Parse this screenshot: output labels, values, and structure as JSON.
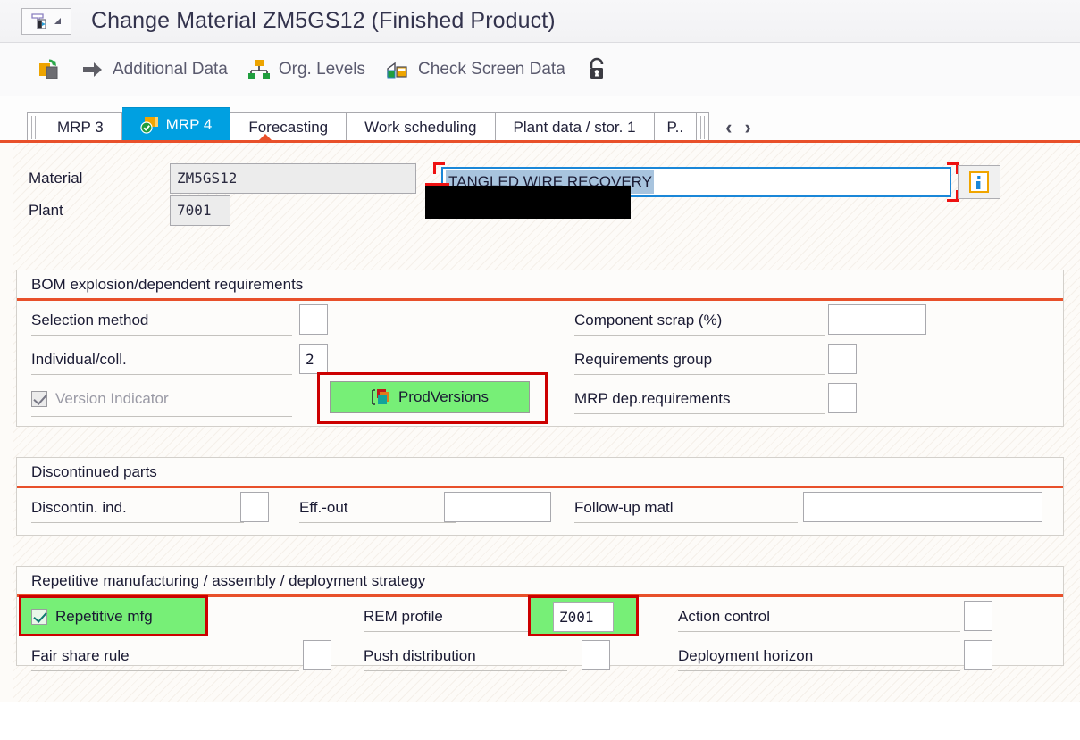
{
  "window": {
    "title": "Change Material ZM5GS12 (Finished Product)",
    "sysmenu_icon": "sap-menu-icon"
  },
  "toolbar": {
    "items": [
      {
        "label": "",
        "icon": "copy-refresh-icon"
      },
      {
        "label": "Additional Data",
        "icon": "arrow-right-icon"
      },
      {
        "label": "Org. Levels",
        "icon": "org-levels-icon"
      },
      {
        "label": "Check Screen Data",
        "icon": "check-screen-data-icon"
      },
      {
        "label": "",
        "icon": "lock-icon"
      }
    ]
  },
  "tabs": {
    "items": [
      {
        "label": "MRP 3",
        "active": false
      },
      {
        "label": "MRP 4",
        "active": true,
        "icon": "mrp4-check-icon"
      },
      {
        "label": "Forecasting",
        "active": false
      },
      {
        "label": "Work scheduling",
        "active": false
      },
      {
        "label": "Plant data / stor. 1",
        "active": false
      },
      {
        "label": "P..",
        "active": false
      }
    ],
    "nav_prev": "‹",
    "nav_next": "›"
  },
  "header": {
    "material_label": "Material",
    "material_value": "ZM5GS12",
    "description_value": "TANGLED WIRE RECOVERY",
    "plant_label": "Plant",
    "plant_value": "7001",
    "info_icon": "info-icon"
  },
  "bom_section": {
    "title": "BOM explosion/dependent requirements",
    "fields": [
      {
        "label": "Selection method",
        "value": ""
      },
      {
        "label": "Individual/coll.",
        "value": "2"
      },
      {
        "label": "Component scrap (%)",
        "value": ""
      },
      {
        "label": "Requirements group",
        "value": ""
      },
      {
        "label": "MRP dep.requirements",
        "value": ""
      }
    ],
    "version_indicator_label": "Version Indicator",
    "version_indicator_checked": true,
    "prodversions_button": "ProdVersions",
    "prodversions_icon": "prodversions-icon"
  },
  "discontinued_section": {
    "title": "Discontinued parts",
    "fields": [
      {
        "label": "Discontin. ind.",
        "value": ""
      },
      {
        "label": "Eff.-out",
        "value": ""
      },
      {
        "label": "Follow-up matl",
        "value": ""
      }
    ]
  },
  "repetitive_section": {
    "title": "Repetitive manufacturing / assembly / deployment strategy",
    "repetitive_mfg_label": "Repetitive mfg",
    "repetitive_mfg_checked": true,
    "fields": [
      {
        "label": "REM profile",
        "value": "Z001"
      },
      {
        "label": "Action control",
        "value": ""
      },
      {
        "label": "Fair share rule",
        "value": ""
      },
      {
        "label": "Push distribution",
        "value": ""
      },
      {
        "label": "Deployment horizon",
        "value": ""
      }
    ]
  },
  "colors": {
    "accent_red": "#e8502a",
    "tab_active": "#00a0e1",
    "highlight_green": "#77ef77",
    "annotation_red": "#cc0000",
    "selection_blue": "#a8c4de"
  }
}
